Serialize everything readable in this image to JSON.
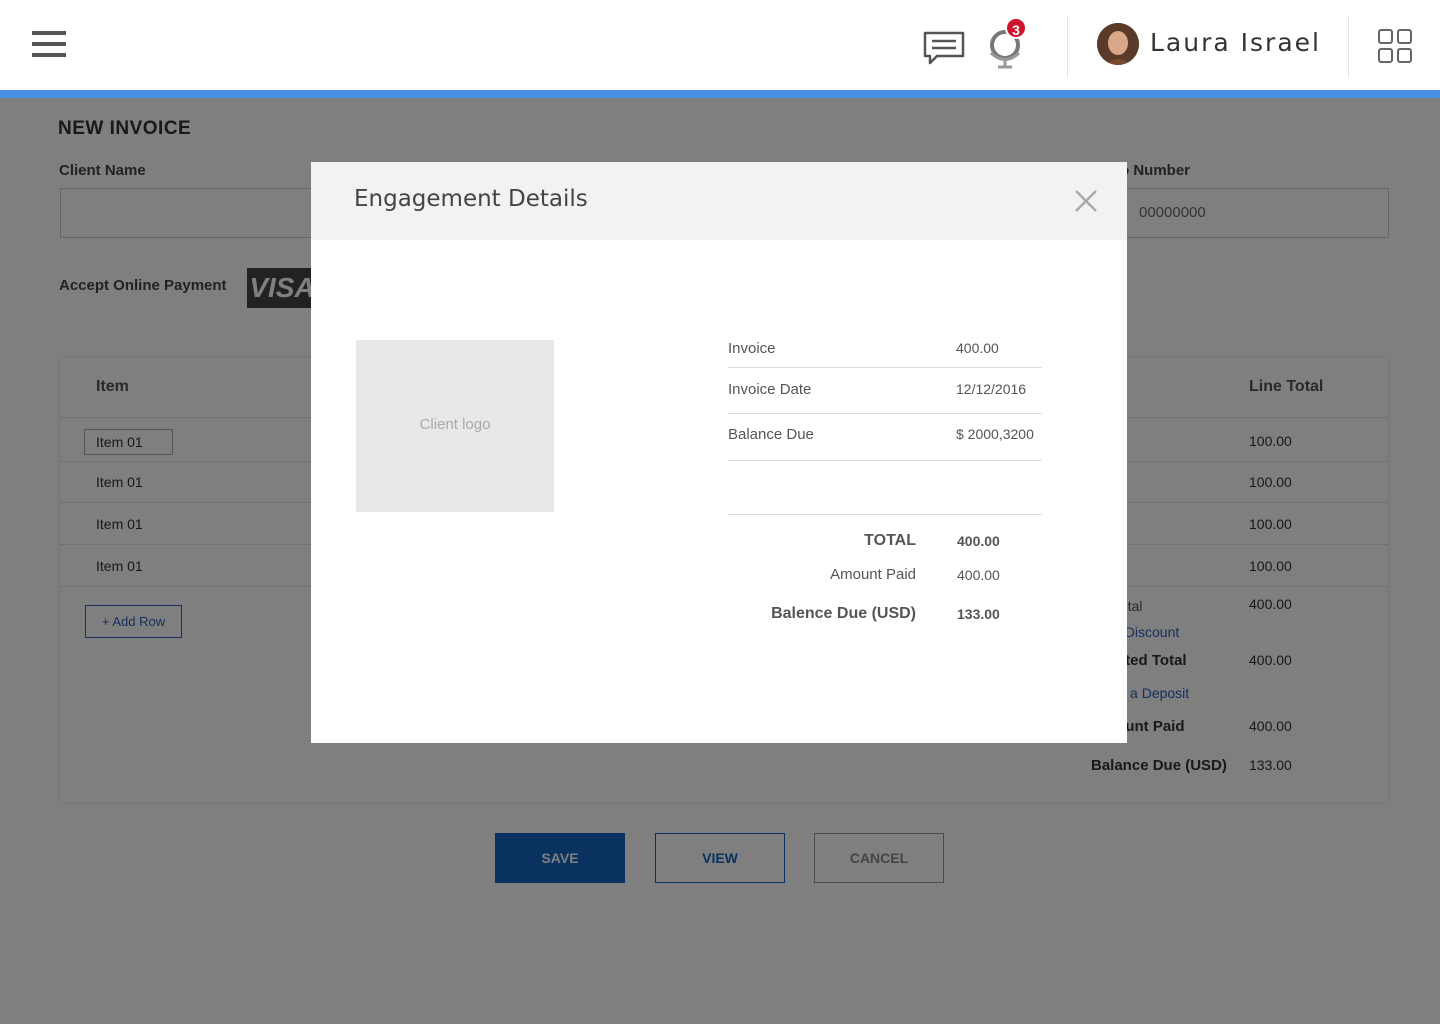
{
  "header": {
    "user_name": "Laura Israel",
    "notification_count": "3"
  },
  "invoice": {
    "title": "NEW INVOICE",
    "client_name_label": "Client Name",
    "po_number_label": "Po Number",
    "po_number_placeholder": "00000000",
    "accept_payment_label": "Accept Online Payment",
    "visa_label": "VISA",
    "columns": {
      "item": "Item",
      "line_total": "Line Total"
    },
    "rows": [
      {
        "item": "Item 01",
        "line_total": "100.00"
      },
      {
        "item": "Item 01",
        "line_total": "100.00"
      },
      {
        "item": "Item 01",
        "line_total": "100.00"
      },
      {
        "item": "Item 01",
        "line_total": "100.00"
      }
    ],
    "add_row_label": "+ Add Row",
    "summary": {
      "subtotal_label": "Subtotal",
      "subtotal_value": "400.00",
      "discount_link": "Add Discount",
      "estimated_total_label": "Estimated Total",
      "estimated_total_value": "400.00",
      "deposit_link": "Request a Deposit",
      "amount_paid_label": "Amount Paid",
      "amount_paid_value": "400.00",
      "balance_due_label": "Balance Due (USD)",
      "balance_due_value": "133.00"
    },
    "buttons": {
      "save": "SAVE",
      "view": "VIEW",
      "cancel": "CANCEL"
    }
  },
  "modal": {
    "title": "Engagement Details",
    "client_logo_placeholder": "Client logo",
    "details": [
      {
        "label": "Invoice",
        "value": "400.00"
      },
      {
        "label": "Invoice Date",
        "value": "12/12/2016"
      },
      {
        "label": "Balance Due",
        "value": "$ 2000,3200"
      }
    ],
    "totals": {
      "total_label": "TOTAL",
      "total_value": "400.00",
      "amount_paid_label": "Amount Paid",
      "amount_paid_value": "400.00",
      "balance_due_label": "Balence Due (USD)",
      "balance_due_value": "133.00"
    }
  },
  "colors": {
    "accent_bar": "#4a90e2",
    "primary_button": "#1565c0",
    "badge": "#d0142b",
    "link": "#2d5fbd"
  }
}
